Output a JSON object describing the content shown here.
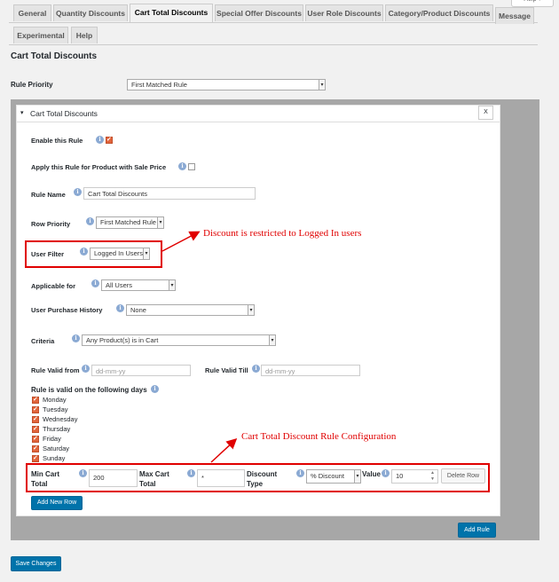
{
  "header": {
    "help_label": "Help ▾"
  },
  "tabs": [
    {
      "label": "General"
    },
    {
      "label": "Quantity Discounts"
    },
    {
      "label": "Cart Total Discounts"
    },
    {
      "label": "Special Offer Discounts"
    },
    {
      "label": "User Role Discounts"
    },
    {
      "label": "Category/Product Discounts"
    },
    {
      "label": "Message"
    },
    {
      "label": "Experimental"
    },
    {
      "label": "Help"
    }
  ],
  "page": {
    "title": "Cart Total Discounts",
    "rule_priority_label": "Rule Priority",
    "rule_priority_value": "First Matched Rule"
  },
  "panel": {
    "title": "Cart Total Discounts",
    "close_label": "X",
    "enable_label": "Enable this Rule",
    "enable_checked": true,
    "sale_label": "Apply this Rule for Product with Sale Price",
    "sale_checked": false,
    "rule_name_label": "Rule Name",
    "rule_name_value": "Cart Total Discounts",
    "row_priority_label": "Row Priority",
    "row_priority_value": "First Matched Rule",
    "user_filter_label": "User Filter",
    "user_filter_value": "Logged In Users",
    "applicable_label": "Applicable for",
    "applicable_value": "All Users",
    "history_label": "User Purchase History",
    "history_value": "None",
    "criteria_label": "Criteria",
    "criteria_value": "Any Product(s) is in Cart",
    "valid_from_label": "Rule Valid from",
    "valid_from_placeholder": "dd-mm-yy",
    "valid_till_label": "Rule Valid Till",
    "valid_till_placeholder": "dd-mm-yy",
    "days_label": "Rule is valid on the following days",
    "days": [
      "Monday",
      "Tuesday",
      "Wednesday",
      "Thursday",
      "Friday",
      "Saturday",
      "Sunday"
    ],
    "row": {
      "min_label_1": "Min Cart",
      "min_label_2": "Total",
      "min_value": "200",
      "max_label_1": "Max Cart",
      "max_label_2": "Total",
      "max_value": "*",
      "type_label_1": "Discount",
      "type_label_2": "Type",
      "type_value": "% Discount",
      "value_label": "Value",
      "value_value": "10",
      "delete_label": "Delete Row"
    },
    "add_row_label": "Add New Row"
  },
  "add_rule_label": "Add Rule",
  "save_label": "Save Changes",
  "annotations": {
    "user_filter": "Discount is restricted to Logged In users",
    "row_config": "Cart Total Discount Rule Configuration",
    "color": "#e00000"
  },
  "colors": {
    "primary": "#0073aa",
    "checkbox": "#e1643b",
    "info": "#8aa9d3"
  }
}
